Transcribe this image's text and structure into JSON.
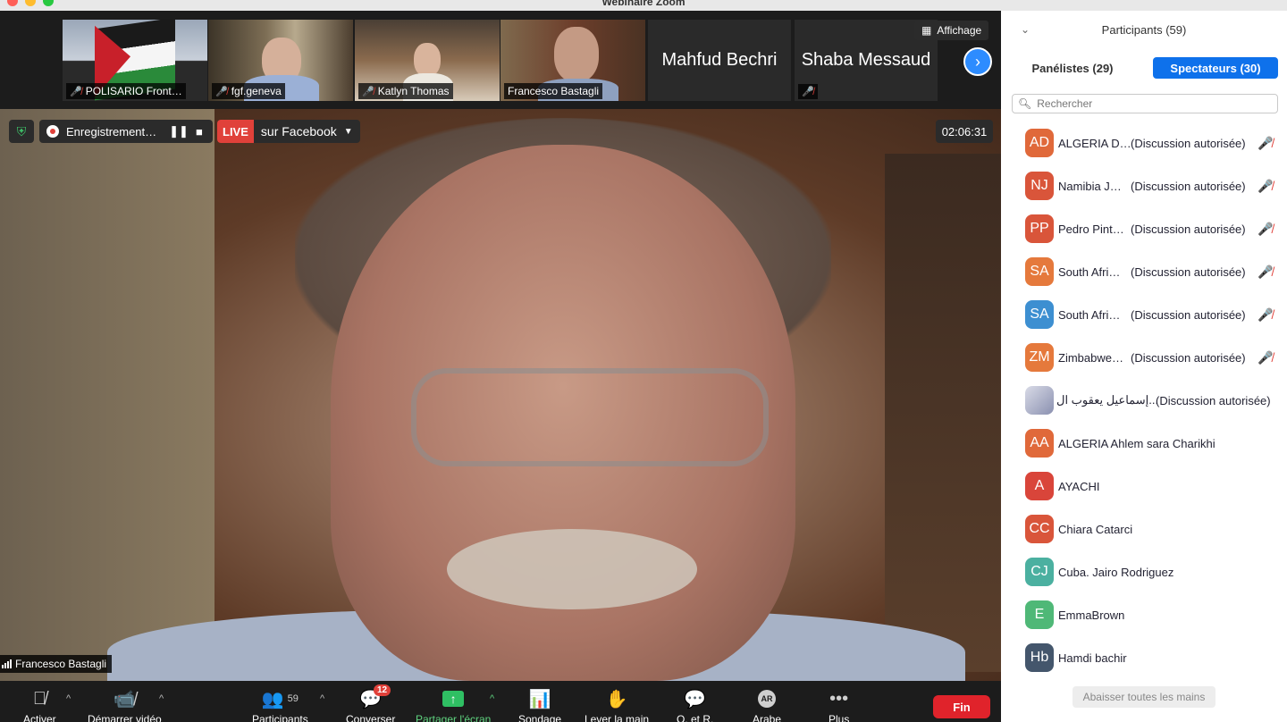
{
  "window": {
    "title": "Webinaire Zoom"
  },
  "thumbnails": [
    {
      "name": "POLISARIO Front…",
      "muted": true
    },
    {
      "name": "fgf.geneva",
      "muted": true
    },
    {
      "name": "Katlyn Thomas",
      "muted": true
    },
    {
      "name": "Francesco Bastagli",
      "muted": false
    },
    {
      "name": "Mahfud Bechri",
      "muted": false
    },
    {
      "name": "Shaba Messaud",
      "muted": true
    }
  ],
  "view_button": {
    "label": "Affichage"
  },
  "recording": {
    "label": "Enregistrement…"
  },
  "live": {
    "badge": "LIVE",
    "target": "sur Facebook"
  },
  "timer": "02:06:31",
  "active_speaker": "Francesco Bastagli",
  "toolbar": {
    "mute_label": "Activer",
    "video_label": "Démarrer vidéo",
    "participants_label": "Participants",
    "participants_count": "59",
    "chat_label": "Converser",
    "chat_badge": "12",
    "share_label": "Partager l'écran",
    "poll_label": "Sondage",
    "raise_hand_label": "Lever la main",
    "qa_label": "Q. et R.",
    "language_label": "Arabe",
    "language_icon": "AR",
    "more_label": "Plus",
    "end_label": "Fin"
  },
  "panel": {
    "title": "Participants (59)",
    "tab_panelists": "Panélistes (29)",
    "tab_attendees": "Spectateurs (30)",
    "search_placeholder": "Rechercher",
    "lower_all_hands": "Abaisser toutes les mains",
    "participants": [
      {
        "initials": "AD",
        "name": "ALGERIA D…",
        "status": "(Discussion autorisée)",
        "color": "#e0693a",
        "muted": true
      },
      {
        "initials": "NJ",
        "name": "Namibia J…",
        "status": "(Discussion autorisée)",
        "color": "#d9553a",
        "muted": true
      },
      {
        "initials": "PP",
        "name": "Pedro Pint…",
        "status": "(Discussion autorisée)",
        "color": "#d9553a",
        "muted": true
      },
      {
        "initials": "SA",
        "name": "South Afri…",
        "status": "(Discussion autorisée)",
        "color": "#e5793c",
        "muted": true
      },
      {
        "initials": "SA",
        "name": "South Afri…",
        "status": "(Discussion autorisée)",
        "color": "#3d8fd1",
        "muted": true
      },
      {
        "initials": "ZM",
        "name": "Zimbabwe…",
        "status": "(Discussion autorisée)",
        "color": "#e5793c",
        "muted": true
      },
      {
        "initials": "",
        "name": "إسماعيل يعقوب ال...",
        "status": "(Discussion autorisée)",
        "color": "photo",
        "muted": false
      },
      {
        "initials": "AA",
        "name": "ALGERIA Ahlem sara Charikhi",
        "status": "",
        "color": "#e0693a",
        "muted": false
      },
      {
        "initials": "A",
        "name": "AYACHI",
        "status": "",
        "color": "#d9453a",
        "muted": false
      },
      {
        "initials": "CC",
        "name": "Chiara Catarci",
        "status": "",
        "color": "#d9553a",
        "muted": false
      },
      {
        "initials": "CJ",
        "name": "Cuba. Jairo Rodriguez",
        "status": "",
        "color": "#4bb0a0",
        "muted": false
      },
      {
        "initials": "E",
        "name": "EmmaBrown",
        "status": "",
        "color": "#4fb877",
        "muted": false
      },
      {
        "initials": "Hb",
        "name": "Hamdi bachir",
        "status": "",
        "color": "#44566c",
        "muted": false
      }
    ]
  }
}
